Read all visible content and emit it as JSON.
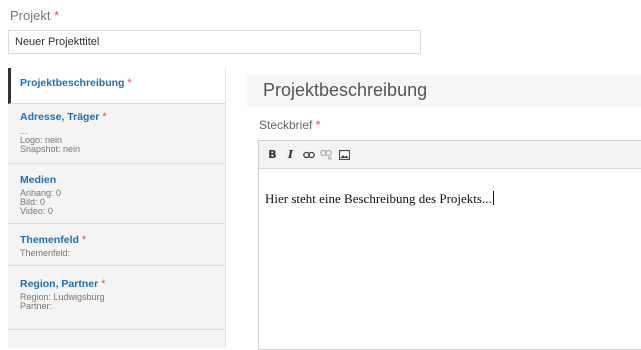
{
  "project": {
    "label": "Projekt",
    "required_mark": "*",
    "title_value": "Neuer Projekttitel"
  },
  "sidebar": {
    "items": [
      {
        "title": "Projektbeschreibung",
        "required": "*",
        "lines": [],
        "active": true
      },
      {
        "title": "Adresse, Träger",
        "required": "*",
        "lines": [
          "...",
          "Logo: nein",
          "Snapshot: nein"
        ]
      },
      {
        "title": "Medien",
        "required": "",
        "lines": [
          "Anhang: 0",
          "Bild: 0",
          "Video: 0"
        ]
      },
      {
        "title": "Themenfeld",
        "required": "*",
        "lines": [
          "Themenfeld:"
        ]
      },
      {
        "title": "Region, Partner",
        "required": "*",
        "lines": [
          "Region: Ludwigsburg",
          "Partner:"
        ]
      }
    ]
  },
  "main": {
    "section_title": "Projektbeschreibung",
    "field_label": "Steckbrief",
    "required_mark": "*",
    "toolbar": {
      "bold": "B",
      "italic": "I",
      "icons": [
        "link-icon",
        "unlink-icon",
        "image-icon"
      ]
    },
    "editor_text": "Hier steht eine Beschreibung des Projekts..."
  },
  "colors": {
    "link_blue": "#1f6fb2",
    "required_red": "#d9534f",
    "sidebar_bg": "#f4f4f4"
  }
}
